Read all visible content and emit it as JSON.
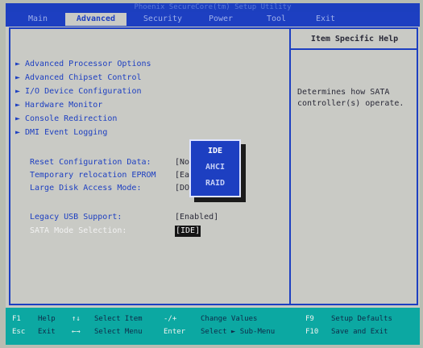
{
  "window": {
    "title": "Phoenix SecureCore(tm) Setup Utility"
  },
  "menu": {
    "tabs": [
      {
        "label": "Main",
        "active": false
      },
      {
        "label": "Advanced",
        "active": true
      },
      {
        "label": "Security",
        "active": false
      },
      {
        "label": "Power",
        "active": false
      },
      {
        "label": "Tool",
        "active": false
      },
      {
        "label": "Exit",
        "active": false
      }
    ]
  },
  "help": {
    "title": "Item Specific Help",
    "text": "Determines how SATA\ncontroller(s) operate."
  },
  "submenus": [
    "Advanced Processor Options",
    "Advanced Chipset Control",
    "I/O Device Configuration",
    "Hardware Monitor",
    "Console Redirection",
    "DMI Event Logging"
  ],
  "settings": [
    {
      "label": "Reset Configuration Data:",
      "value": "[No"
    },
    {
      "label": "Temporary relocation EPROM",
      "value": "[Ea"
    },
    {
      "label": "Large Disk Access Mode:",
      "value": "[DO"
    },
    {
      "label": "Legacy USB Support:",
      "value": "[Enabled]"
    },
    {
      "label": "SATA Mode Selection:",
      "value": "[IDE]"
    }
  ],
  "popup": {
    "options": [
      "IDE",
      "AHCI",
      "RAID"
    ],
    "selected": "IDE"
  },
  "footer": {
    "rows": [
      [
        {
          "key": "F1",
          "action": "Help"
        },
        {
          "key": "↑↓",
          "action": "Select Item"
        },
        {
          "key": "-/+",
          "action": "Change Values"
        },
        {
          "key": "F9",
          "action": "Setup Defaults"
        }
      ],
      [
        {
          "key": "Esc",
          "action": "Exit"
        },
        {
          "key": "←→",
          "action": "Select Menu"
        },
        {
          "key": "Enter",
          "action": "Select ► Sub-Menu"
        },
        {
          "key": "F10",
          "action": "Save and Exit"
        }
      ]
    ]
  },
  "colors": {
    "bios_blue": "#1d3fc1",
    "panel_gray": "#c9cac5",
    "footer_teal": "#0ca8a2",
    "highlight_black": "#151515"
  }
}
